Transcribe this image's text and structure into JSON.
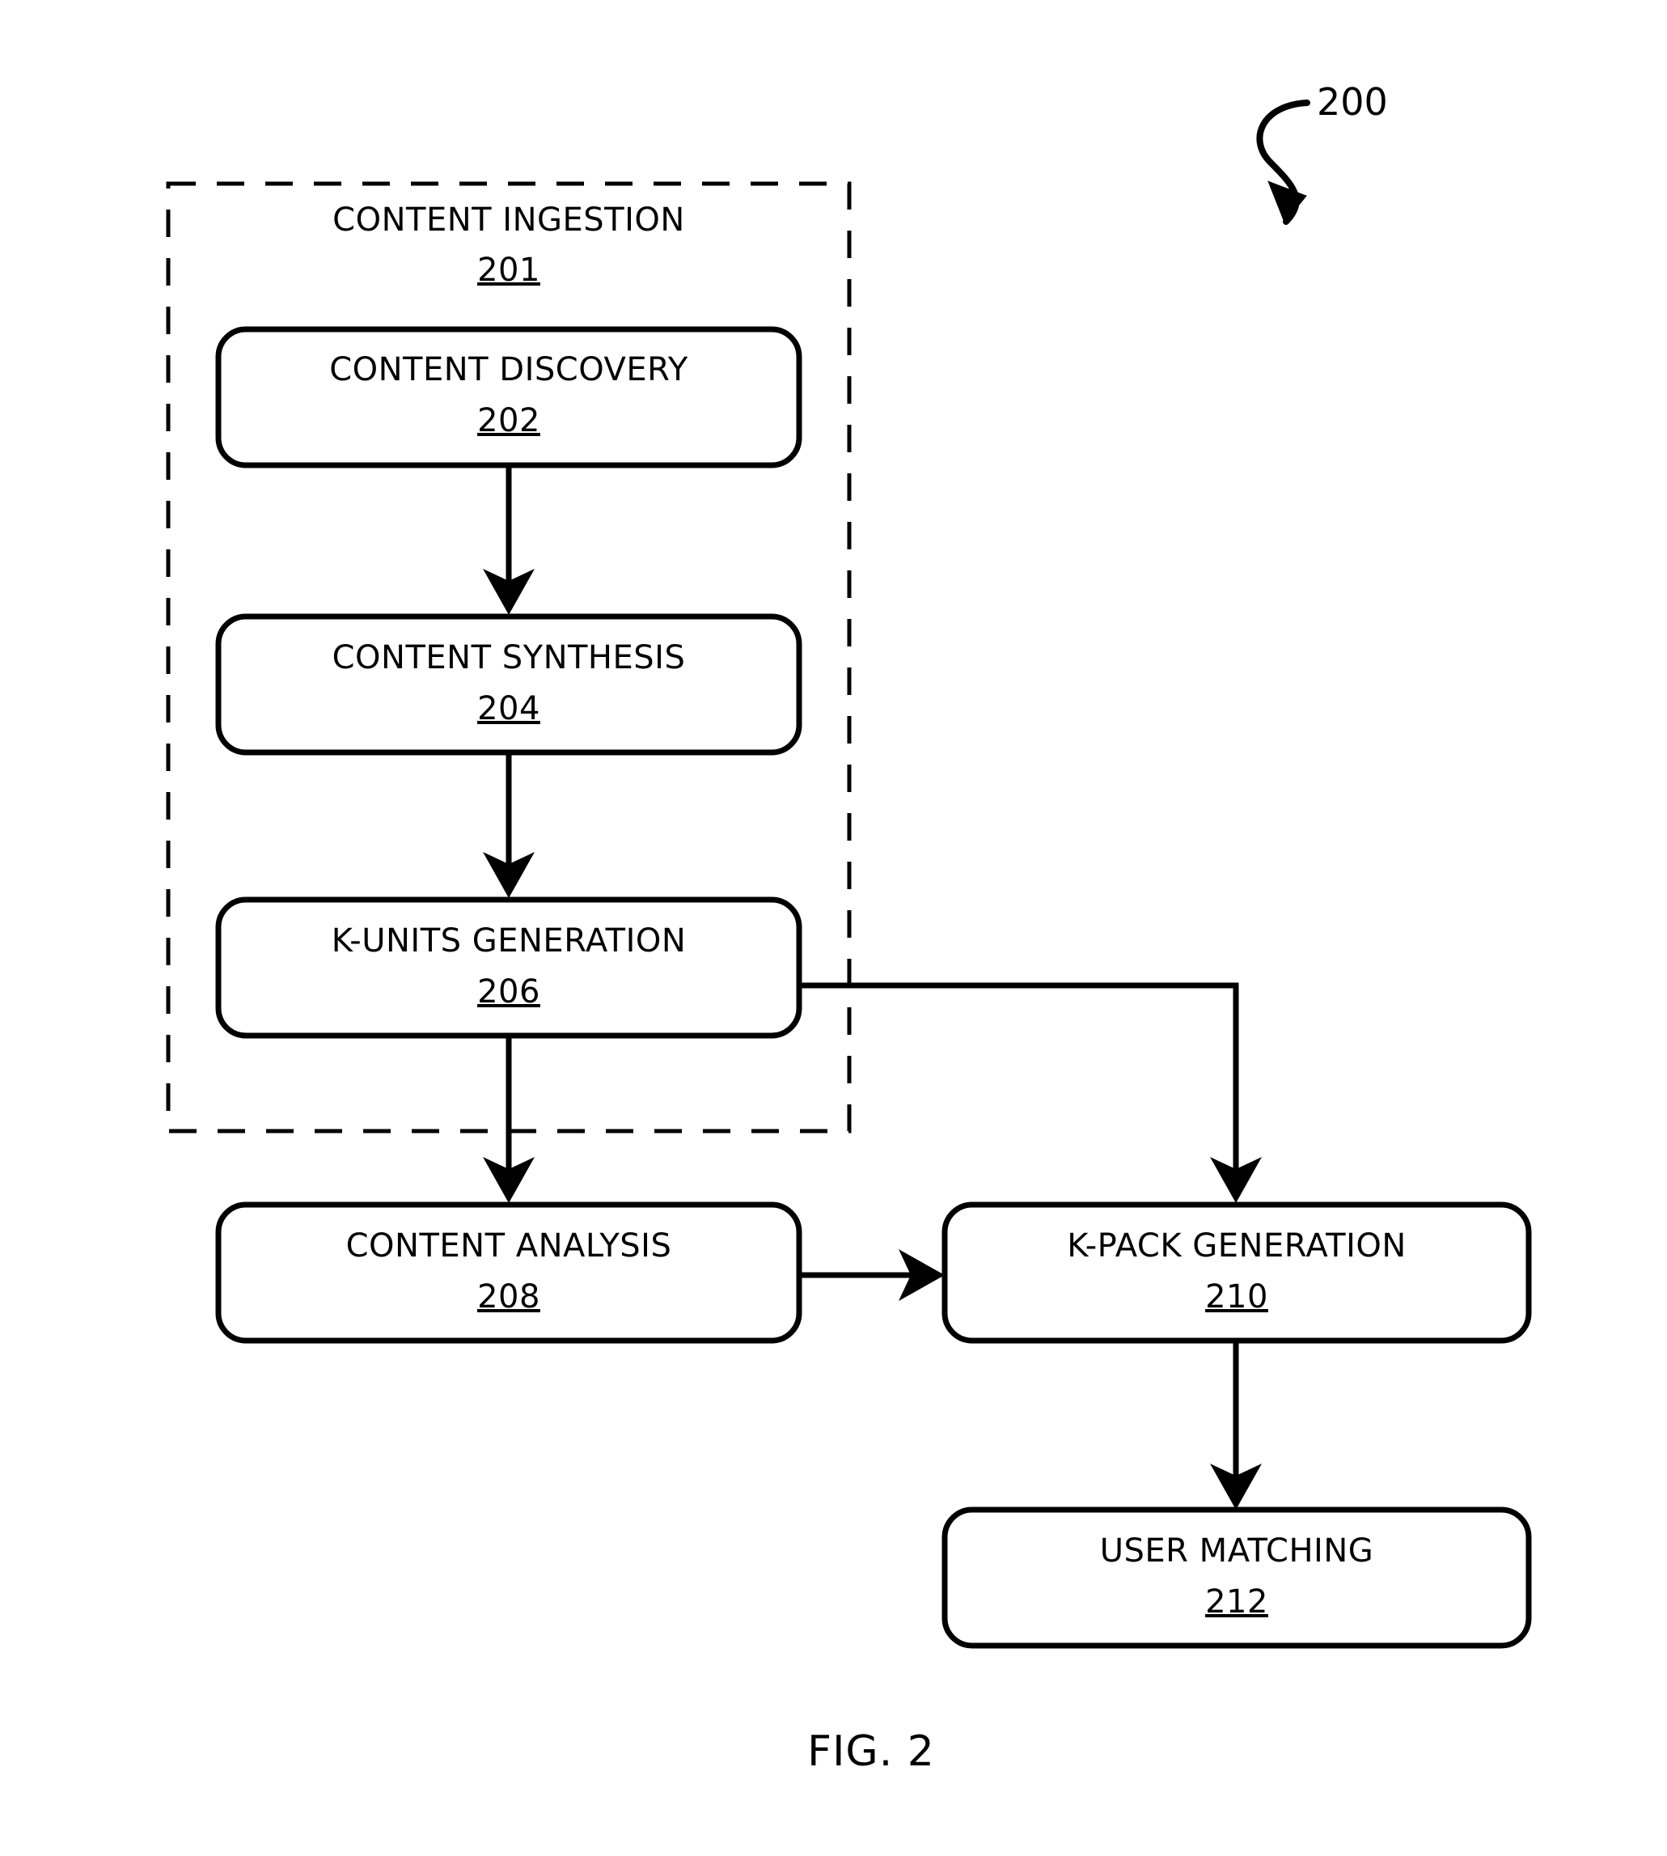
{
  "figure": {
    "caption": "FIG. 2",
    "reference_numeral": "200"
  },
  "group": {
    "name": "content-ingestion-group",
    "title": "CONTENT INGESTION",
    "ref": "201"
  },
  "nodes": [
    {
      "id": "content-discovery",
      "title": "CONTENT DISCOVERY",
      "ref": "202"
    },
    {
      "id": "content-synthesis",
      "title": "CONTENT SYNTHESIS",
      "ref": "204"
    },
    {
      "id": "k-units-generation",
      "title": "K-UNITS GENERATION",
      "ref": "206"
    },
    {
      "id": "content-analysis",
      "title": "CONTENT ANALYSIS",
      "ref": "208"
    },
    {
      "id": "k-pack-generation",
      "title": "K-PACK GENERATION",
      "ref": "210"
    },
    {
      "id": "user-matching",
      "title": "USER MATCHING",
      "ref": "212"
    }
  ],
  "connections": [
    {
      "from": "content-discovery",
      "to": "content-synthesis"
    },
    {
      "from": "content-synthesis",
      "to": "k-units-generation"
    },
    {
      "from": "k-units-generation",
      "to": "content-analysis"
    },
    {
      "from": "k-units-generation",
      "to": "k-pack-generation"
    },
    {
      "from": "content-analysis",
      "to": "k-pack-generation"
    },
    {
      "from": "k-pack-generation",
      "to": "user-matching"
    }
  ]
}
